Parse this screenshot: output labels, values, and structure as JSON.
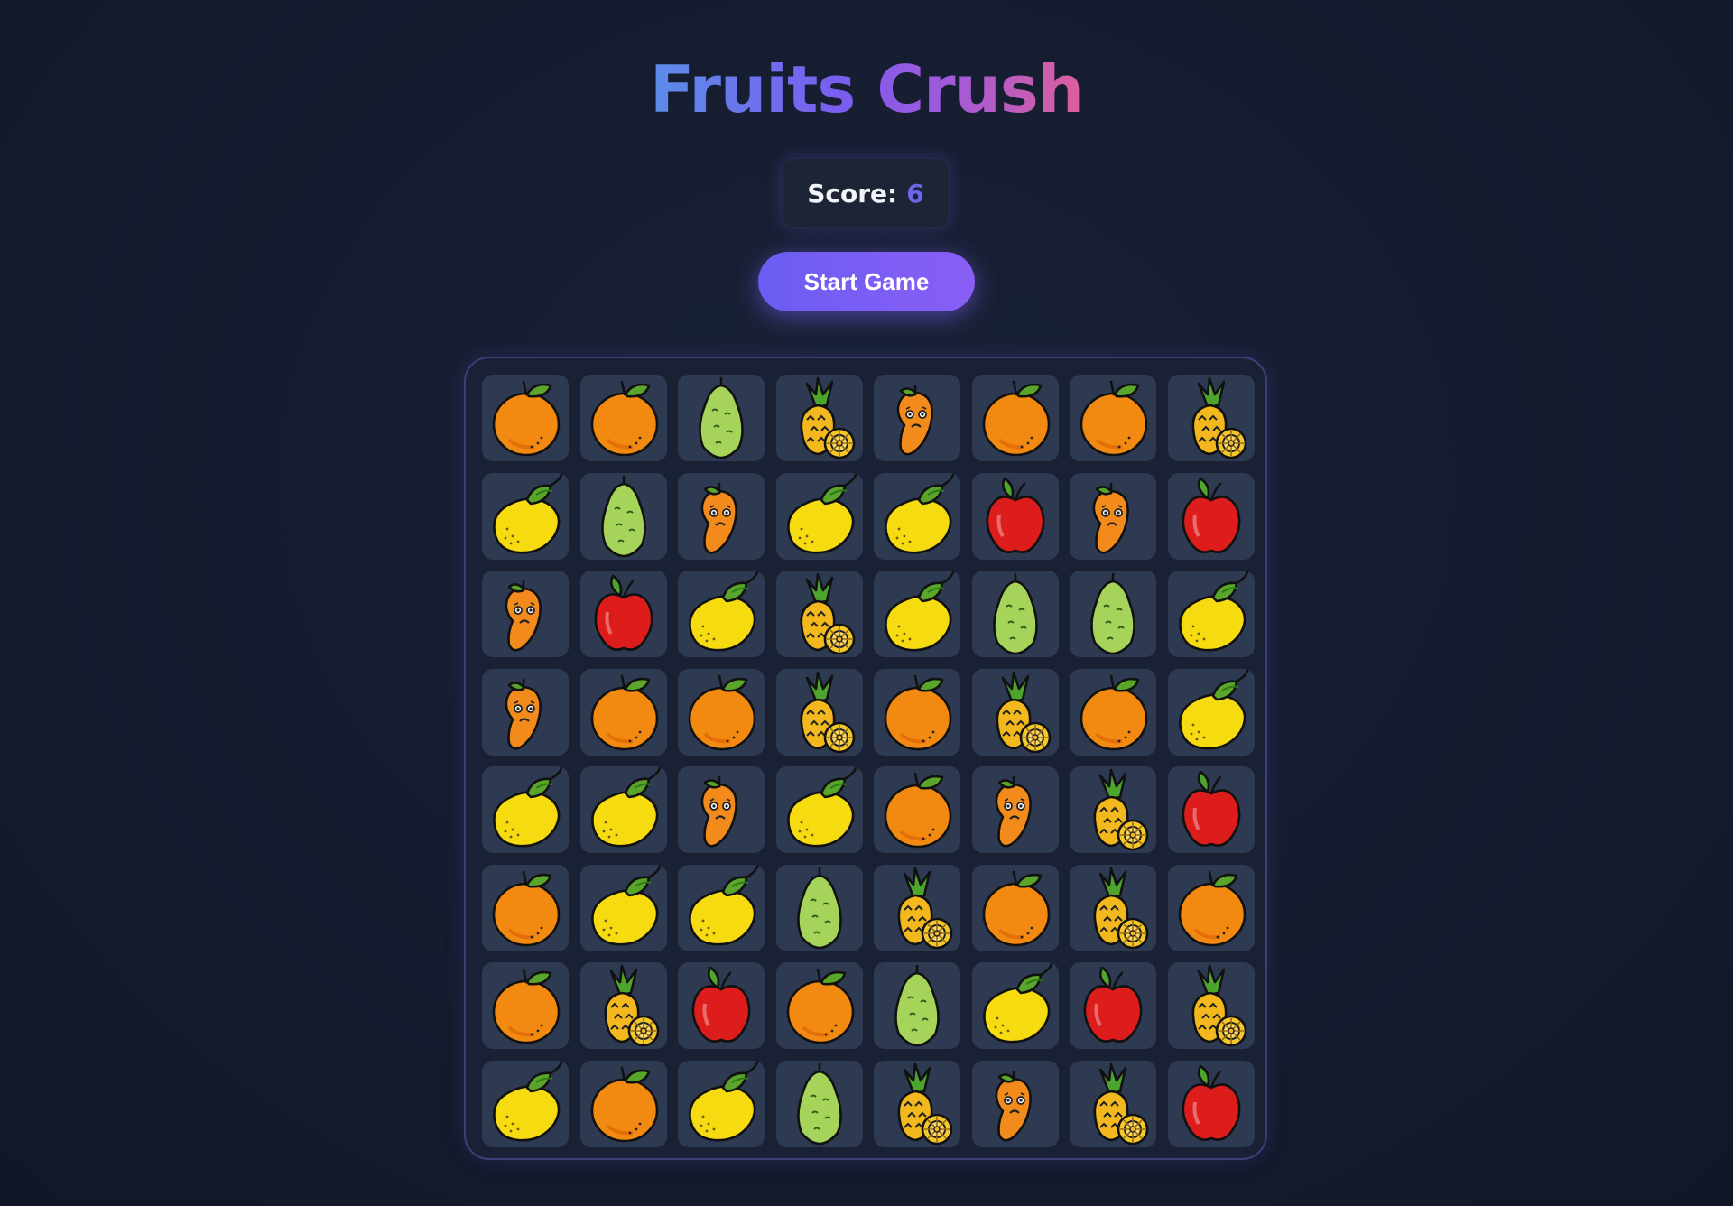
{
  "title": "Fruits Crush",
  "score": {
    "label": "Score:",
    "value": "6"
  },
  "start_button": "Start Game",
  "colors": {
    "background": "#161d31",
    "accent": "#7b5cf0",
    "tile": "#2e3a51",
    "board_border": "#3a3f7a"
  },
  "board": {
    "rows": 8,
    "cols": 8,
    "grid": [
      [
        "orange",
        "orange",
        "guava",
        "pineapple",
        "mango",
        "orange",
        "orange",
        "pineapple"
      ],
      [
        "lemon",
        "guava",
        "mango",
        "lemon",
        "lemon",
        "apple",
        "mango",
        "apple"
      ],
      [
        "mango",
        "apple",
        "lemon",
        "pineapple",
        "lemon",
        "guava",
        "guava",
        "lemon"
      ],
      [
        "mango",
        "orange",
        "orange",
        "pineapple",
        "orange",
        "pineapple",
        "orange",
        "lemon"
      ],
      [
        "lemon",
        "lemon",
        "mango",
        "lemon",
        "orange",
        "mango",
        "pineapple",
        "apple"
      ],
      [
        "orange",
        "lemon",
        "lemon",
        "guava",
        "pineapple",
        "orange",
        "pineapple",
        "orange"
      ],
      [
        "orange",
        "pineapple",
        "apple",
        "orange",
        "guava",
        "lemon",
        "apple",
        "pineapple"
      ],
      [
        "lemon",
        "orange",
        "lemon",
        "guava",
        "pineapple",
        "mango",
        "pineapple",
        "apple"
      ]
    ]
  }
}
